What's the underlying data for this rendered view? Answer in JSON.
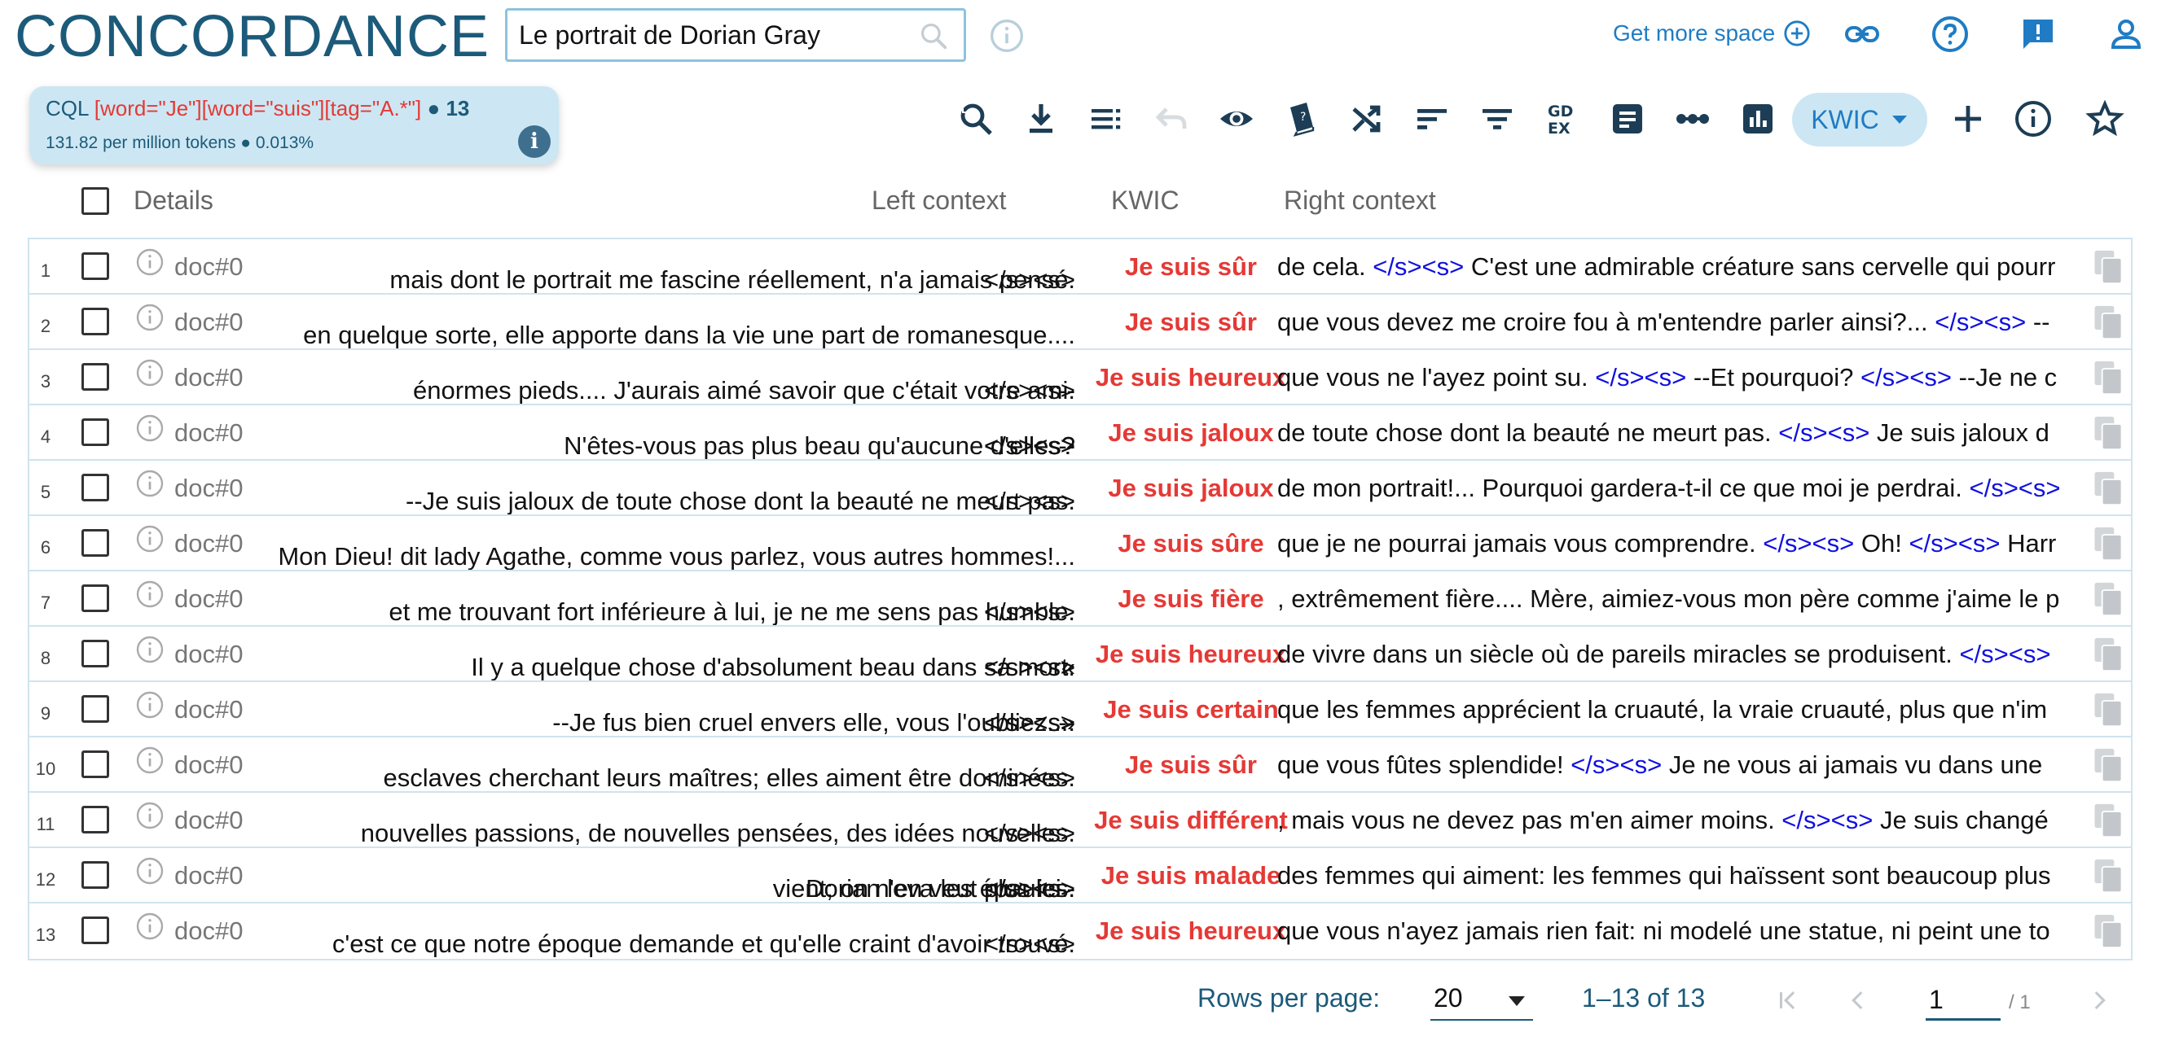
{
  "app": {
    "title": "CONCORDANCE"
  },
  "search": {
    "value": "Le portrait de Dorian Gray"
  },
  "header_links": {
    "more_space": "Get more space"
  },
  "cql": {
    "label": "CQL",
    "query": "[word=\"Je\"][word=\"suis\"][tag=\"A.*\"]",
    "separator": "●",
    "count": "13",
    "stats": "131.82 per million tokens ● 0.013%"
  },
  "toolbar": {
    "view_mode": "KWIC"
  },
  "table": {
    "headers": {
      "details": "Details",
      "left": "Left context",
      "kwic": "KWIC",
      "right": "Right context"
    },
    "rows": [
      {
        "num": "1",
        "doc": "doc#0",
        "left": "mais dont le portrait me fascine réellement, n'a jamais pensé. </s><s>",
        "kwic": "Je suis sûr",
        "right": "de cela. </s><s> C'est une admirable créature sans cervelle qui pourr"
      },
      {
        "num": "2",
        "doc": "doc#0",
        "left": "en quelque sorte, elle apporte dans la vie une part de romanesque....",
        "kwic": "Je suis sûr",
        "right": "que vous devez me croire fou à m'entendre parler ainsi?... </s><s> --"
      },
      {
        "num": "3",
        "doc": "doc#0",
        "left": "énormes pieds.... J'aurais aimé savoir que c'était votre ami. </s><s> --",
        "kwic": "Je suis heureux",
        "right": "que vous ne l'ayez point su. </s><s> --Et pourquoi? </s><s> --Je ne c"
      },
      {
        "num": "4",
        "doc": "doc#0",
        "left": "elles? </s><s> N'êtes-vous pas plus beau qu'aucune d'elles? </s><s> --",
        "kwic": "Je suis jaloux",
        "right": "de toute chose dont la beauté ne meurt pas. </s><s> Je suis jaloux d"
      },
      {
        "num": "5",
        "doc": "doc#0",
        "left": "--Je suis jaloux de toute chose dont la beauté ne meurt pas. </s><s>",
        "kwic": "Je suis jaloux",
        "right": "de mon portrait!... Pourquoi gardera-t-il ce que moi je perdrai. </s><s>"
      },
      {
        "num": "6",
        "doc": "doc#0",
        "left": "Mon Dieu! dit lady Agathe, comme vous parlez, vous autres hommes!...",
        "kwic": "Je suis sûre",
        "right": "que je ne pourrai jamais vous comprendre. </s><s> Oh! </s><s> Harr"
      },
      {
        "num": "7",
        "doc": "doc#0",
        "left": "et me trouvant fort inférieure à lui, je ne me sens pas humble. </s><s>",
        "kwic": "Je suis fière",
        "right": ", extrêmement fière.... Mère, aimiez-vous mon père comme j'aime le p"
      },
      {
        "num": "8",
        "doc": "doc#0",
        "left": "</s><s> Il y a quelque chose d'absolument beau dans sa mort. </s><s> «",
        "kwic": "Je suis heureux",
        "right": "de vivre dans un siècle où de pareils miracles se produisent. </s><s>"
      },
      {
        "num": "9",
        "doc": "doc#0",
        "left": "...» </s><s> --Je fus bien cruel envers elle, vous l'oubliez.... </s><s> --",
        "kwic": "Je suis certain",
        "right": "que les femmes apprécient la cruauté, la vraie cruauté, plus que n'im"
      },
      {
        "num": "10",
        "doc": "doc#0",
        "left": "esclaves cherchant leurs maîtres; elles aiment être dominées. </s><s>",
        "kwic": "Je suis sûr",
        "right": "que vous fûtes splendide! </s><s> Je ne vous ai jamais vu dans une"
      },
      {
        "num": "11",
        "doc": "doc#0",
        "left": "nouvelles passions, de nouvelles pensées, des idées nouvelles. </s><s>",
        "kwic": "Je suis différent",
        "right": ", mais vous ne devez pas m'en aimer moins. </s><s> Je suis changé"
      },
      {
        "num": "12",
        "doc": "doc#0",
        "left": "vient; on n'en veut plus ici.. </s><s> Dorian leva les épaules. </s><s> --",
        "kwic": "Je suis malade",
        "right": "des femmes qui aiment: les femmes qui haïssent sont beaucoup plus"
      },
      {
        "num": "13",
        "doc": "doc#0",
        "left": "c'est ce que notre époque demande et qu'elle craint d'avoir trouvé. </s><s>",
        "kwic": "Je suis heureux",
        "right": "que vous n'ayez jamais rien fait: ni modelé une statue, ni peint une to"
      }
    ]
  },
  "pagination": {
    "rows_per_page_label": "Rows per page:",
    "rows_per_page": "20",
    "range": "1–13 of 13",
    "page": "1",
    "of_pages": "/ 1"
  },
  "colors": {
    "brand": "#1c5a7a",
    "accent": "#1f7cc4",
    "kwic": "#e53935",
    "tag": "#1010e0",
    "cql_bg": "#cce7f3"
  }
}
